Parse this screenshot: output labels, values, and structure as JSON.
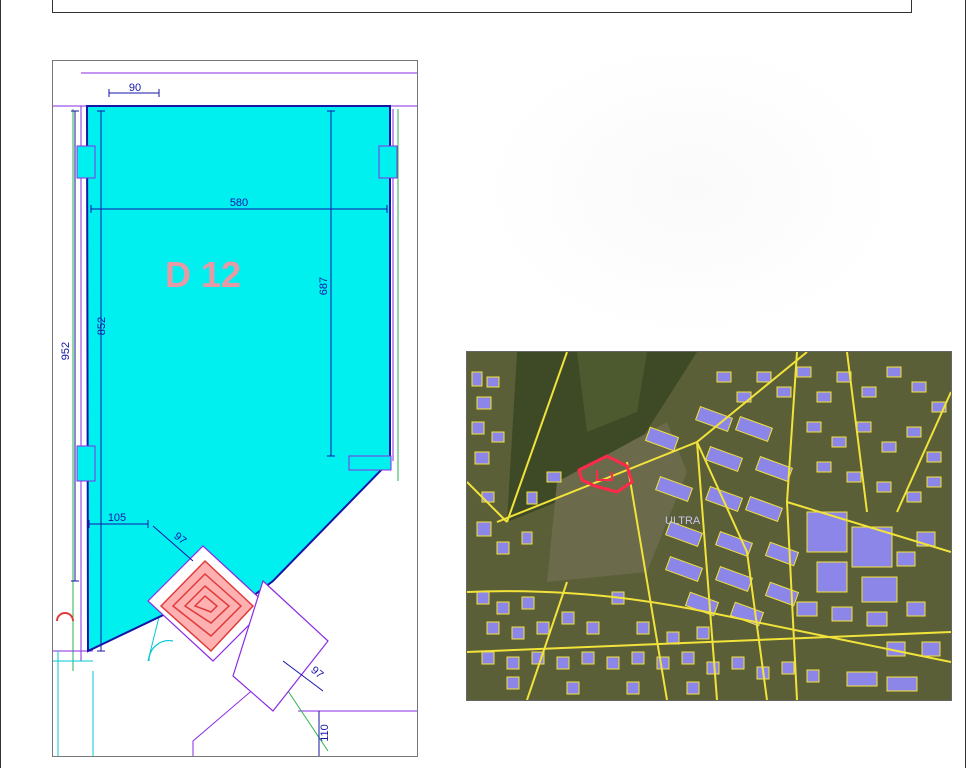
{
  "floor_plan": {
    "unit_label": "D 12",
    "dimensions": {
      "top": "90",
      "width": "580",
      "height_inner": "687",
      "height_mid": "852",
      "height_outer": "952",
      "bottom_left": "105",
      "diagonal": "97",
      "stair_diag": "97",
      "bottom": "110"
    },
    "colors": {
      "unit_fill": "#00f0f0",
      "outline": "#1515a8",
      "label": "#e79aa6",
      "stair": "#e03a3a",
      "walls": "#8a2be2"
    }
  },
  "location_map": {
    "street_label": "ULTRA",
    "colors": {
      "roads": "#f2e33a",
      "buildings": "#8b86e8",
      "plot": "#ff2a4a"
    }
  }
}
